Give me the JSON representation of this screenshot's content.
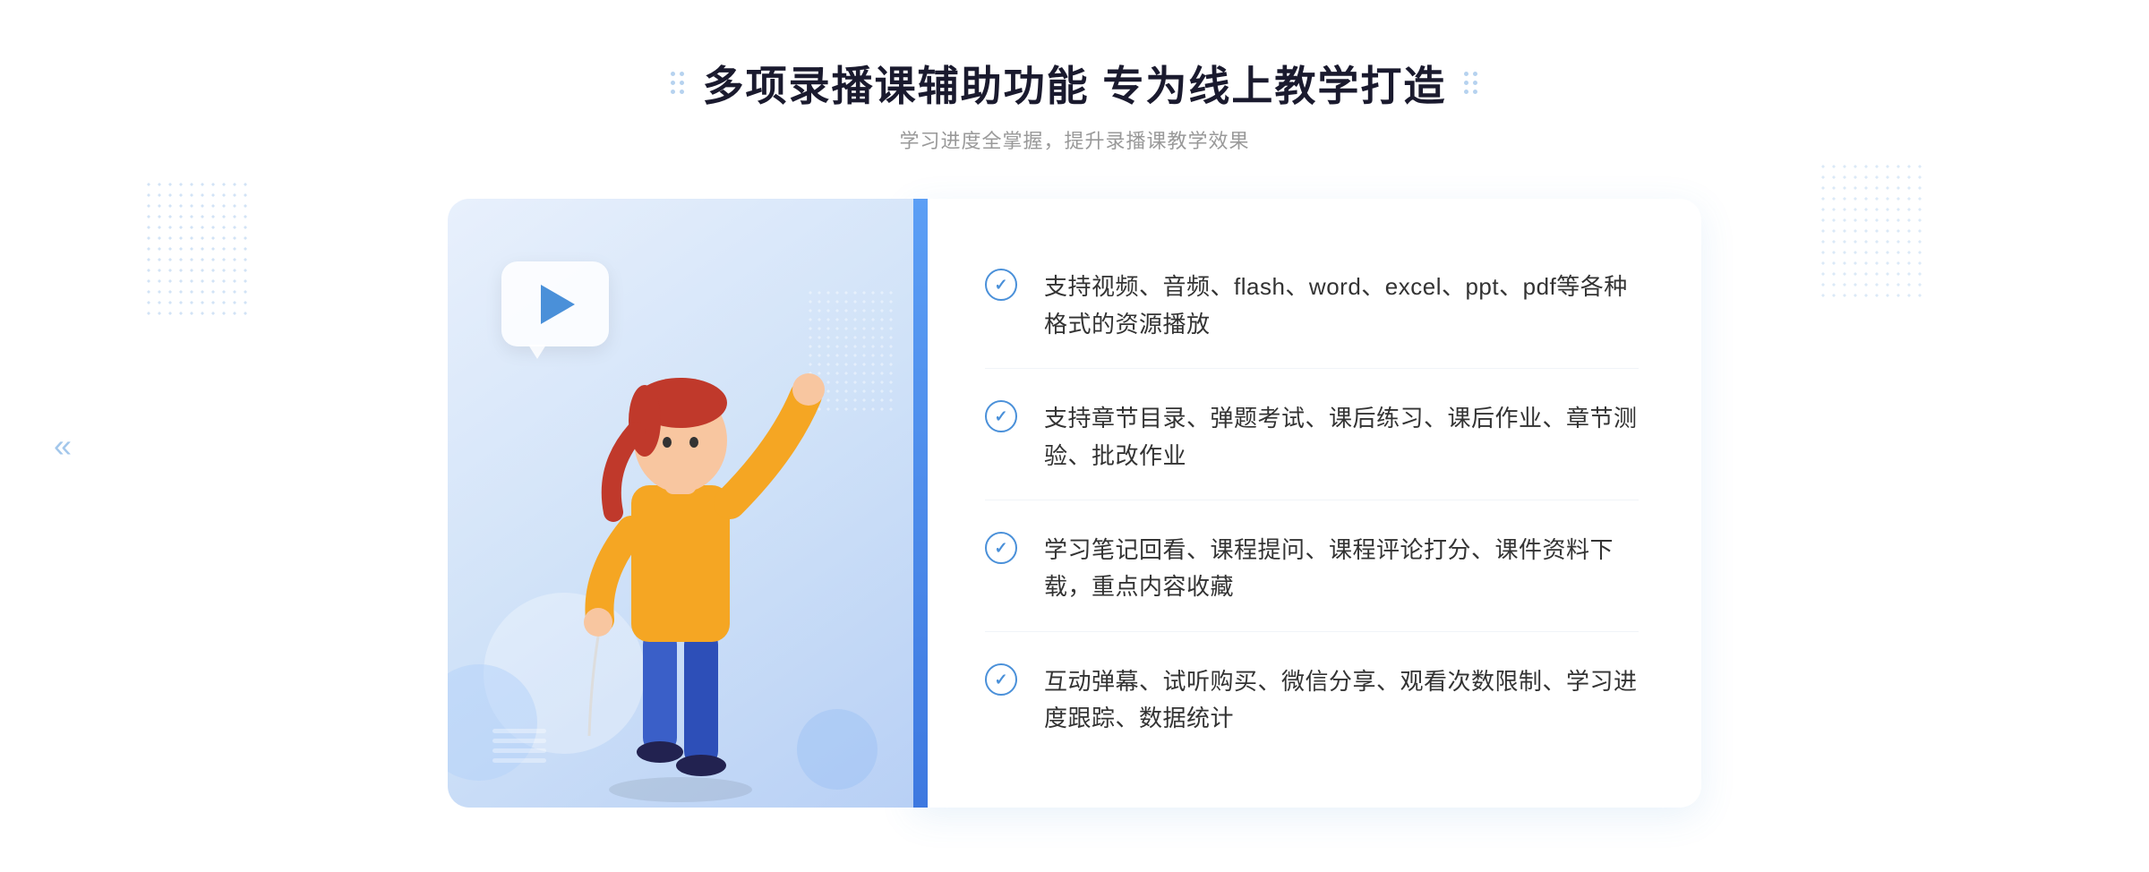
{
  "page": {
    "title": "多项录播课辅助功能 专为线上教学打造",
    "subtitle": "学习进度全掌握，提升录播课教学效果",
    "decorator_label_left": "decorators",
    "decorator_label_right": "decorators"
  },
  "features": [
    {
      "id": 1,
      "text": "支持视频、音频、flash、word、excel、ppt、pdf等各种格式的资源播放"
    },
    {
      "id": 2,
      "text": "支持章节目录、弹题考试、课后练习、课后作业、章节测验、批改作业"
    },
    {
      "id": 3,
      "text": "学习笔记回看、课程提问、课程评论打分、课件资料下载，重点内容收藏"
    },
    {
      "id": 4,
      "text": "互动弹幕、试听购买、微信分享、观看次数限制、学习进度跟踪、数据统计"
    }
  ],
  "icons": {
    "check": "✓",
    "chevron_left": "«",
    "play": "▶"
  },
  "colors": {
    "primary": "#4a90d9",
    "accent": "#3d78e0",
    "title": "#1a1a2e",
    "subtitle": "#999999",
    "text": "#333333",
    "border": "#f0f4f8",
    "illus_bg_start": "#e8f0fc",
    "illus_bg_end": "#b8d0f5"
  }
}
